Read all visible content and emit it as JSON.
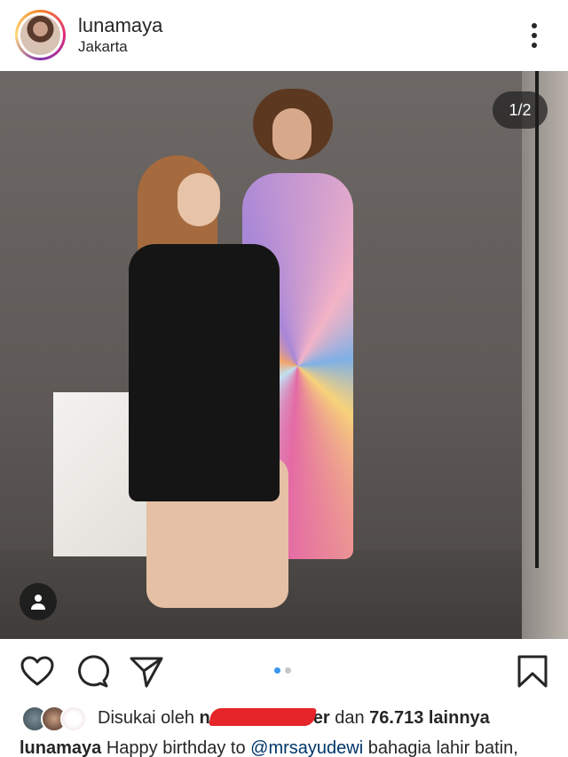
{
  "post": {
    "username": "lunamaya",
    "location": "Jakarta",
    "carousel_counter": "1/2",
    "carousel_total": 2,
    "carousel_active_index": 0
  },
  "likes": {
    "prefix": "Disukai oleh",
    "name_visible_start": "n",
    "name_visible_end": "er",
    "connector": "dan",
    "count_text": "76.713 lainnya"
  },
  "caption": {
    "username": "lunamaya",
    "text_before": "Happy birthday to",
    "mention": "@mrsayudewi",
    "text_after": "bahagia lahir batin,"
  },
  "icons": {
    "more": "more-vertical-icon",
    "like": "heart-icon",
    "comment": "comment-icon",
    "share": "send-icon",
    "save": "bookmark-icon",
    "tag": "user-tag-icon"
  },
  "colors": {
    "text": "#262626",
    "mention": "#003569",
    "active_dot": "#3897f0",
    "inactive_dot": "#c7c7c7"
  }
}
